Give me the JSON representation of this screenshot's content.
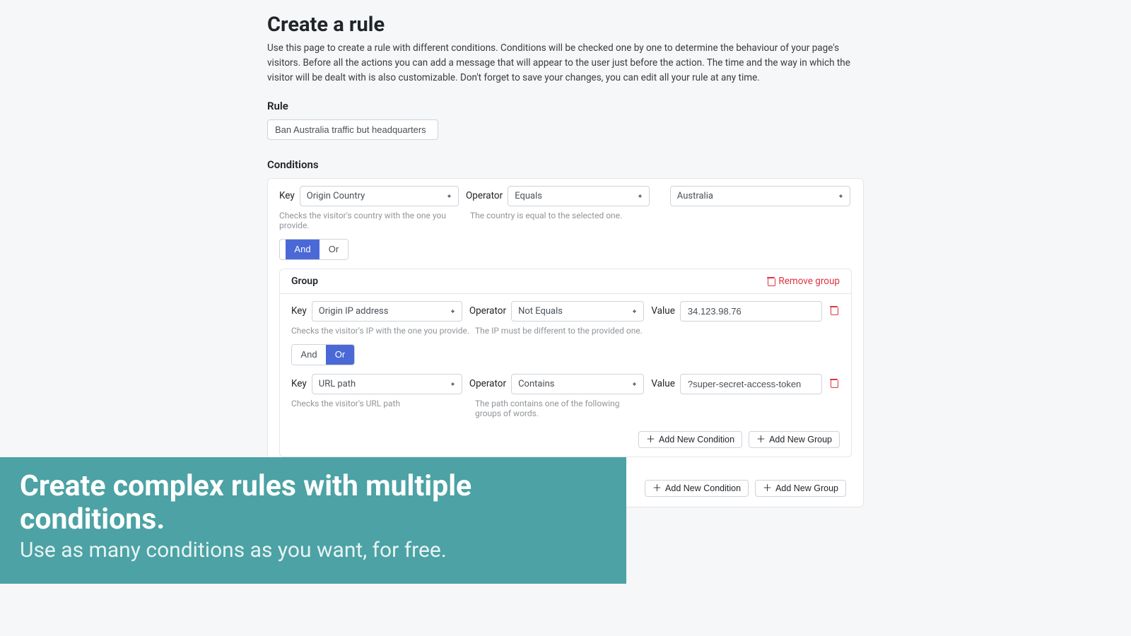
{
  "header": {
    "title": "Create a rule",
    "intro": "Use this page to create a rule with different conditions. Conditions will be checked one by one to determine the behaviour of your page's visitors. Before all the actions you can add a message that will appear to the user just before the action. The time and the way in which the visitor will be dealt with is also customizable. Don't forget to save your changes, you can edit all your rule at any time."
  },
  "rule": {
    "label": "Rule",
    "value": "Ban Australia traffic but headquarters"
  },
  "conditions": {
    "label": "Conditions",
    "top": {
      "key_label": "Key",
      "key_value": "Origin Country",
      "key_hint": "Checks the visitor's country with the one you provide.",
      "op_label": "Operator",
      "op_value": "Equals",
      "op_hint": "The country is equal to the selected one.",
      "val_value": "Australia",
      "logic": {
        "and": "And",
        "or": "Or",
        "active": "and"
      }
    },
    "group": {
      "title": "Group",
      "remove_label": "Remove group",
      "c1": {
        "key_label": "Key",
        "key_value": "Origin IP address",
        "key_hint": "Checks the visitor's IP with the one you provide.",
        "op_label": "Operator",
        "op_value": "Not Equals",
        "op_hint": "The IP must be different to the provided one.",
        "val_label": "Value",
        "val_value": "34.123.98.76"
      },
      "logic": {
        "and": "And",
        "or": "Or",
        "active": "or"
      },
      "c2": {
        "key_label": "Key",
        "key_value": "URL path",
        "key_hint": "Checks the visitor's URL path",
        "op_label": "Operator",
        "op_value": "Contains",
        "op_hint": "The path contains one of the following groups of words.",
        "val_label": "Value",
        "val_value": "?super-secret-access-token"
      },
      "actions": {
        "add_condition": "Add New Condition",
        "add_group": "Add New Group"
      }
    },
    "bottom_actions": {
      "add_condition": "Add New Condition",
      "add_group": "Add New Group"
    }
  },
  "overlay": {
    "big": "Create complex rules with multiple conditions.",
    "small": "Use as many conditions as you want, for free."
  }
}
